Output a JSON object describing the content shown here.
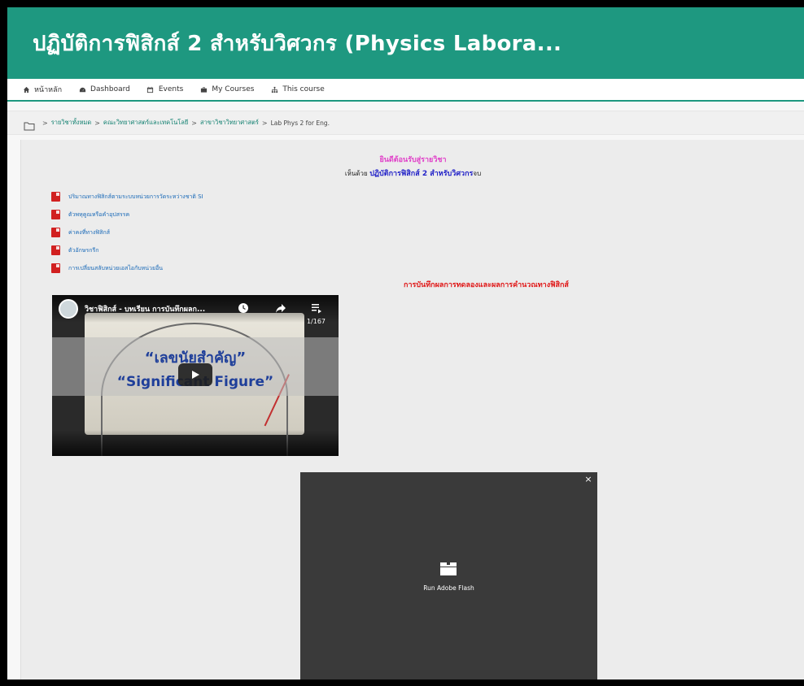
{
  "header": {
    "title": "ปฏิบัติการฟิสิกส์ 2 สำหรับวิศวกร (Physics Labora..."
  },
  "navbar": {
    "items": [
      {
        "label": "หน้าหลัก",
        "icon": "home-icon"
      },
      {
        "label": "Dashboard",
        "icon": "dashboard-icon"
      },
      {
        "label": "Events",
        "icon": "calendar-icon"
      },
      {
        "label": "My Courses",
        "icon": "briefcase-icon"
      },
      {
        "label": "This course",
        "icon": "sitemap-icon"
      }
    ]
  },
  "breadcrumb": {
    "items": [
      "รายวิชาทั้งหมด",
      "คณะวิทยาศาสตร์และเทคโนโลยี",
      "สาขาวิชาวิทยาศาสตร์",
      "Lab Phys 2 for Eng."
    ],
    "separator": ">"
  },
  "main": {
    "welcome": "ยินดีต้อนรับสู่รายวิชา",
    "welcome_prefix": "เห็นด้วย ",
    "welcome_course": "ปฏิบัติการฟิสิกส์ 2 สำหรับวิศวกร",
    "welcome_suffix": "จบ",
    "files": [
      "ปริมาณทางฟิสิกส์ตามระบบหน่วยการวัดระหว่างชาติ SI",
      "ตัวพหุคูณหรือคำอุปสรรค",
      "ค่าคงที่ทางฟิสิกส์",
      "ตัวอักษรกรีก",
      "การเปลี่ยนสลับหน่วยเอสไอกับหน่วยอื่น"
    ],
    "section_heading": "การบันทึกผลการทดลองและผลการคำนวณทางฟิสิกส์"
  },
  "video": {
    "title": "วิชาฟิสิกส์ - บทเรียน การบันทึกผลก...",
    "counter": "1/167",
    "overlay_line1": "“เลขนัยสำคัญ”",
    "overlay_line2": "“Significant Figure”"
  },
  "flash": {
    "label": "Run Adobe Flash",
    "close": "×"
  },
  "colors": {
    "header_bg": "#1e9880",
    "welcome": "#e040c8",
    "course_name": "#2424c8",
    "section_heading": "#e01818",
    "file_link": "#1a6ab8",
    "pdf_icon": "#d12020"
  }
}
